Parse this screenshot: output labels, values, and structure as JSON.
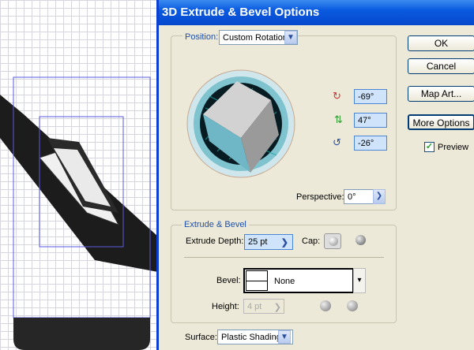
{
  "dialog": {
    "title": "3D Extrude & Bevel Options"
  },
  "position": {
    "label": "Position:",
    "value": "Custom Rotation",
    "rot_x": "-69°",
    "rot_y": "47°",
    "rot_z": "-26°",
    "perspective_label": "Perspective:",
    "perspective": "0°"
  },
  "extrude": {
    "group_label": "Extrude & Bevel",
    "depth_label": "Extrude Depth:",
    "depth": "25 pt",
    "cap_label": "Cap:",
    "bevel_label": "Bevel:",
    "bevel": "None",
    "height_label": "Height:",
    "height": "4 pt"
  },
  "surface": {
    "label": "Surface:",
    "value": "Plastic Shading"
  },
  "buttons": {
    "ok": "OK",
    "cancel": "Cancel",
    "map_art": "Map Art...",
    "more_options": "More Options"
  },
  "preview": {
    "label": "Preview",
    "checked": true
  }
}
